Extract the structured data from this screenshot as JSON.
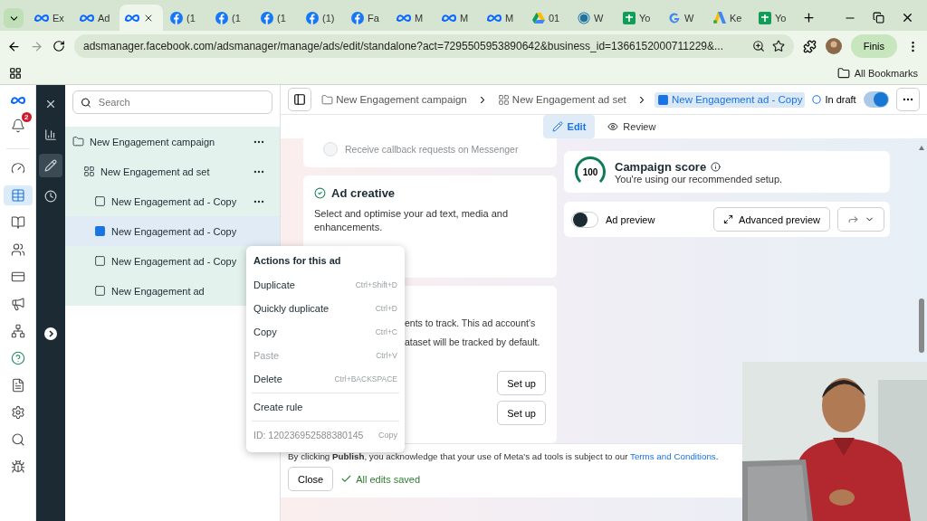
{
  "browser": {
    "tabs": [
      {
        "label": "Ex",
        "kind": "meta",
        "selected": false
      },
      {
        "label": "Ad",
        "kind": "meta",
        "selected": false
      },
      {
        "kind": "meta",
        "selected": true
      },
      {
        "label": "(1",
        "kind": "facebook",
        "selected": false
      },
      {
        "label": "(1",
        "kind": "facebook",
        "selected": false
      },
      {
        "label": "(1",
        "kind": "facebook",
        "selected": false
      },
      {
        "label": "(1)",
        "kind": "facebook",
        "selected": false
      },
      {
        "label": "Fa",
        "kind": "facebook",
        "selected": false
      },
      {
        "label": "M",
        "kind": "meta",
        "selected": false
      },
      {
        "label": "M",
        "kind": "meta",
        "selected": false
      },
      {
        "label": "M",
        "kind": "meta",
        "selected": false
      },
      {
        "label": "01",
        "kind": "drive",
        "selected": false
      },
      {
        "label": "W",
        "kind": "wordpress",
        "selected": false
      },
      {
        "label": "Yo",
        "kind": "sheets",
        "selected": false
      },
      {
        "label": "W",
        "kind": "google",
        "selected": false
      },
      {
        "label": "Ke",
        "kind": "ads",
        "selected": false
      },
      {
        "label": "Yo",
        "kind": "sheets",
        "selected": false
      }
    ],
    "address": "adsmanager.facebook.com/adsmanager/manage/ads/edit/standalone?act=7295505953890642&business_id=1366152000711229&...",
    "profile_button": "Finis",
    "bookmarks": "All Bookmarks"
  },
  "rail": {
    "notifications": "2",
    "items": [
      {
        "kind": "dashboard",
        "selected": false
      },
      {
        "kind": "table",
        "selected": true
      },
      {
        "kind": "pages",
        "selected": false
      },
      {
        "kind": "people",
        "selected": false
      },
      {
        "kind": "card",
        "selected": false
      },
      {
        "kind": "megaphone",
        "selected": false
      },
      {
        "kind": "graph",
        "selected": false
      },
      {
        "kind": "help",
        "selected": false
      },
      {
        "kind": "document",
        "selected": false
      },
      {
        "kind": "settings",
        "selected": false
      },
      {
        "kind": "search",
        "selected": false
      },
      {
        "kind": "bug",
        "selected": false
      }
    ]
  },
  "tools": [
    {
      "kind": "chart",
      "selected": false
    },
    {
      "kind": "edit",
      "selected": true
    },
    {
      "kind": "history",
      "selected": false
    }
  ],
  "tree": {
    "search_placeholder": "Search",
    "items": [
      {
        "label": "New Engagement campaign",
        "kind": "campaign",
        "selected": false,
        "children": [
          {
            "label": "New Engagement ad set",
            "kind": "adset",
            "selected": false,
            "children": [
              {
                "label": "New Engagement ad - Copy",
                "kind": "ad",
                "selected": false
              },
              {
                "label": "New Engagement ad - Copy",
                "kind": "ad",
                "selected": true
              },
              {
                "label": "New Engagement ad - Copy",
                "kind": "ad",
                "selected": false
              },
              {
                "label": "New Engagement ad",
                "kind": "ad",
                "selected": false
              }
            ]
          }
        ]
      }
    ]
  },
  "header": {
    "breadcrumbs": [
      {
        "label": "New Engagement campaign",
        "kind": "campaign",
        "selected": false
      },
      {
        "label": "New Engagement ad set",
        "kind": "adset",
        "selected": false
      },
      {
        "label": "New Engagement ad - Copy",
        "kind": "ad",
        "selected": true
      }
    ],
    "status": "In draft",
    "on": true
  },
  "mode_tabs": [
    {
      "label": "Edit",
      "kind": "edit",
      "selected": true
    },
    {
      "label": "Review",
      "kind": "review",
      "selected": false
    }
  ],
  "editor": {
    "callback_option": {
      "label": "Receive callback requests on Messenger",
      "checked": false
    },
    "ad_creative": {
      "title": "Ad creative",
      "description": "Select and optimise your ad text, media and enhancements."
    },
    "tracking": {
      "lines": [
        "ents to track. This ad account's",
        "ataset will be tracked by default."
      ],
      "buttons": [
        "Set up",
        "Set up"
      ]
    }
  },
  "score": {
    "value": "100",
    "title": "Campaign score",
    "subtitle": "You're using our recommended setup."
  },
  "preview": {
    "label": "Ad preview",
    "on": false,
    "button": "Advanced preview"
  },
  "menu": {
    "title": "Actions for this ad",
    "items": [
      {
        "label": "Duplicate",
        "shortcut": "Ctrl+Shift+D",
        "disabled": false
      },
      {
        "label": "Quickly duplicate",
        "shortcut": "Ctrl+D",
        "disabled": false
      },
      {
        "label": "Copy",
        "shortcut": "Ctrl+C",
        "disabled": false
      },
      {
        "label": "Paste",
        "shortcut": "Ctrl+V",
        "disabled": true
      },
      {
        "label": "Delete",
        "shortcut": "Ctrl+BACKSPACE",
        "disabled": false
      }
    ],
    "action_item": "Create rule",
    "id": "ID: 120236952588380145",
    "copy": "Copy"
  },
  "footer": {
    "notice": "By clicking **Publish**, you acknowledge that your use of Meta's ad tools is subject to our",
    "link": "Terms and Conditions",
    "notice_end": ".",
    "close": "Close",
    "saved": "All edits saved"
  }
}
